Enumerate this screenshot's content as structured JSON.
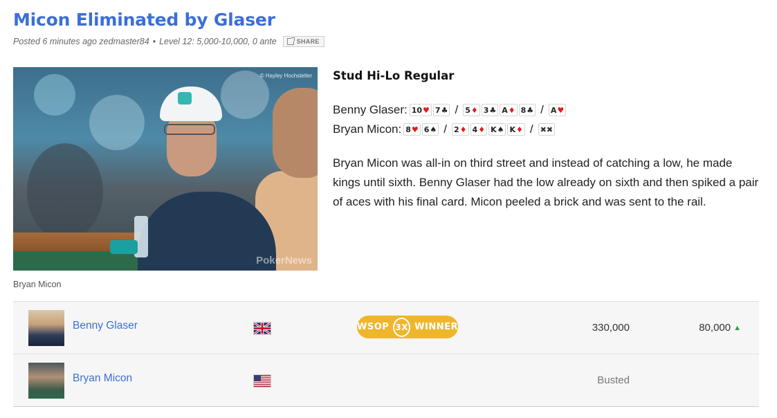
{
  "post": {
    "title": "Micon Eliminated by Glaser",
    "posted_prefix": "Posted",
    "time_ago": "6 minutes ago",
    "author": "zedmaster84",
    "separator": "•",
    "level": "Level 12: 5,000-10,000, 0 ante",
    "share_label": "SHARE"
  },
  "photo": {
    "credit": "© Hayley Hochstetler",
    "watermark": "PokerNews",
    "caption": "Bryan Micon"
  },
  "hand": {
    "game": "Stud Hi-Lo Regular",
    "players": [
      {
        "name": "Benny Glaser:",
        "groups": [
          [
            {
              "rank": "10",
              "suit": "♥",
              "color": "red"
            },
            {
              "rank": "7",
              "suit": "♣",
              "color": "black"
            }
          ],
          [
            {
              "rank": "5",
              "suit": "♦",
              "color": "red"
            },
            {
              "rank": "3",
              "suit": "♣",
              "color": "black"
            },
            {
              "rank": "A",
              "suit": "♦",
              "color": "red"
            },
            {
              "rank": "8",
              "suit": "♣",
              "color": "black"
            }
          ],
          [
            {
              "rank": "A",
              "suit": "♥",
              "color": "red"
            }
          ]
        ]
      },
      {
        "name": "Bryan Micon:",
        "groups": [
          [
            {
              "rank": "8",
              "suit": "♥",
              "color": "red"
            },
            {
              "rank": "6",
              "suit": "♠",
              "color": "black"
            }
          ],
          [
            {
              "rank": "2",
              "suit": "♦",
              "color": "red"
            },
            {
              "rank": "4",
              "suit": "♦",
              "color": "red"
            },
            {
              "rank": "K",
              "suit": "♠",
              "color": "black"
            },
            {
              "rank": "K",
              "suit": "♦",
              "color": "red"
            }
          ],
          [
            {
              "rank": "✖✖",
              "suit": "",
              "color": "blank"
            }
          ]
        ]
      }
    ],
    "slash": "/",
    "description": "Bryan Micon was all-in on third street and instead of catching a low, he made kings until sixth. Benny Glaser had the low already on sixth and then spiked a pair of aces with his final card. Micon peeled a brick and was sent to the rail."
  },
  "players_table": [
    {
      "name": "Benny Glaser",
      "flag": "uk-flag",
      "badge": {
        "left": "WSOP",
        "middle": "3X",
        "right": "WINNER"
      },
      "chips": "330,000",
      "progress": "80,000",
      "trend": "▲"
    },
    {
      "name": "Bryan Micon",
      "flag": "us-flag",
      "status": "Busted"
    }
  ],
  "colors": {
    "link_blue": "#3a6fd8",
    "badge_gold": "#f0b62b",
    "heart_red": "#e11b1b",
    "up_green": "#2a9d3a"
  }
}
